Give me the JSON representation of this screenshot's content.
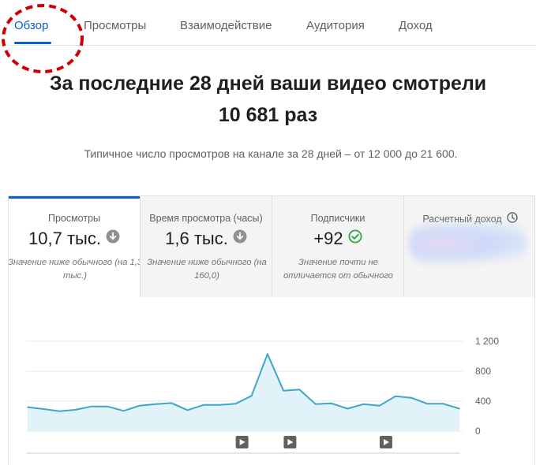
{
  "tabs": [
    {
      "label": "Обзор",
      "active": true
    },
    {
      "label": "Просмотры",
      "active": false
    },
    {
      "label": "Взаимодействие",
      "active": false
    },
    {
      "label": "Аудитория",
      "active": false
    },
    {
      "label": "Доход",
      "active": false
    }
  ],
  "headline": {
    "line1": "За последние 28 дней ваши видео смотрели",
    "line2": "10 681 раз"
  },
  "subline": "Типичное число просмотров на канале за 28 дней – от 12 000 до 21 600.",
  "metrics": [
    {
      "label": "Просмотры",
      "value": "10,7 тыс.",
      "status_icon": "below-arrow-icon",
      "note": "Значение ниже обычного (на 1,3 тыс.)",
      "selected": true
    },
    {
      "label": "Время просмотра (часы)",
      "value": "1,6 тыс.",
      "status_icon": "below-arrow-icon",
      "note": "Значение ниже обычного (на 160,0)"
    },
    {
      "label": "Подписчики",
      "value": "+92",
      "status_icon": "check-circle-icon",
      "note": "Значение почти не отличается от обычного"
    },
    {
      "label": "Расчетный доход",
      "value": "",
      "status_icon": "clock-icon",
      "note": "",
      "value_obscured": true
    }
  ],
  "colors": {
    "accent": "#065fd4",
    "highlight_circle": "#cc0000",
    "line": "#3ea6c8",
    "area": "#e1f3f8",
    "check": "#2ba640",
    "muted_icon": "#909090"
  },
  "chart_data": {
    "type": "area",
    "y_ticks": [
      "1 200",
      "800",
      "400",
      "0"
    ],
    "ylim": [
      0,
      1200
    ],
    "x": [
      1,
      2,
      3,
      4,
      5,
      6,
      7,
      8,
      9,
      10,
      11,
      12,
      13,
      14,
      15,
      16,
      17,
      18,
      19,
      20,
      21,
      22,
      23,
      24,
      25,
      26,
      27,
      28
    ],
    "values": [
      320,
      295,
      265,
      285,
      330,
      330,
      270,
      340,
      360,
      375,
      280,
      350,
      350,
      365,
      470,
      1030,
      540,
      555,
      360,
      370,
      300,
      360,
      340,
      465,
      445,
      365,
      365,
      300
    ],
    "grid": true,
    "video_markers_at": [
      15,
      18,
      24
    ]
  }
}
